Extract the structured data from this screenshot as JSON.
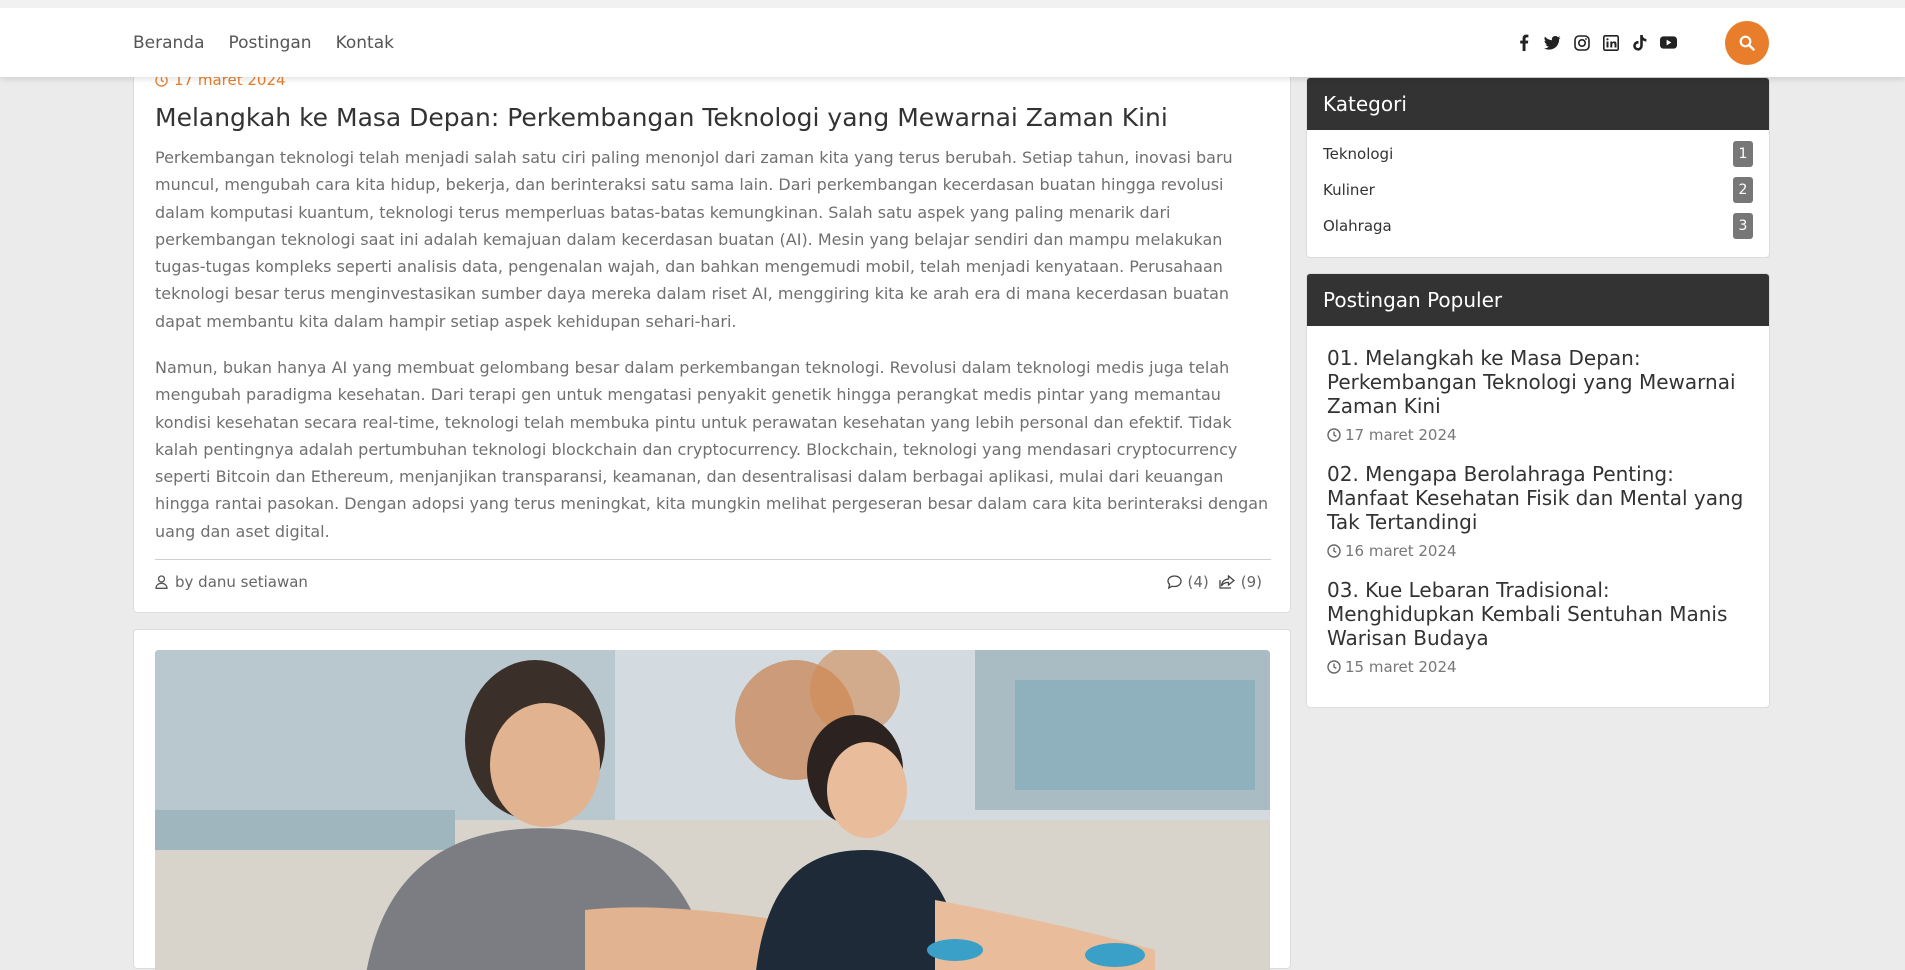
{
  "nav": {
    "items": [
      "Beranda",
      "Postingan",
      "Kontak"
    ]
  },
  "social": [
    "facebook-icon",
    "twitter-icon",
    "instagram-icon",
    "linkedin-icon",
    "tiktok-icon",
    "youtube-icon"
  ],
  "colors": {
    "accent": "#e87e2b",
    "header_dark": "#333333",
    "background": "#ebebeb"
  },
  "post1": {
    "date": "17 maret 2024",
    "title": "Melangkah ke Masa Depan: Perkembangan Teknologi yang Mewarnai Zaman Kini",
    "paragraph1": "Perkembangan teknologi telah menjadi salah satu ciri paling menonjol dari zaman kita yang terus berubah. Setiap tahun, inovasi baru muncul, mengubah cara kita hidup, bekerja, dan berinteraksi satu sama lain. Dari perkembangan kecerdasan buatan hingga revolusi dalam komputasi kuantum, teknologi terus memperluas batas-batas kemungkinan. Salah satu aspek yang paling menarik dari perkembangan teknologi saat ini adalah kemajuan dalam kecerdasan buatan (AI). Mesin yang belajar sendiri dan mampu melakukan tugas-tugas kompleks seperti analisis data, pengenalan wajah, dan bahkan mengemudi mobil, telah menjadi kenyataan. Perusahaan teknologi besar terus menginvestasikan sumber daya mereka dalam riset AI, menggiring kita ke arah era di mana kecerdasan buatan dapat membantu kita dalam hampir setiap aspek kehidupan sehari-hari.",
    "paragraph2": "Namun, bukan hanya AI yang membuat gelombang besar dalam perkembangan teknologi. Revolusi dalam teknologi medis juga telah mengubah paradigma kesehatan. Dari terapi gen untuk mengatasi penyakit genetik hingga perangkat medis pintar yang memantau kondisi kesehatan secara real-time, teknologi telah membuka pintu untuk perawatan kesehatan yang lebih personal dan efektif. Tidak kalah pentingnya adalah pertumbuhan teknologi blockchain dan cryptocurrency. Blockchain, teknologi yang mendasari cryptocurrency seperti Bitcoin dan Ethereum, menjanjikan transparansi, keamanan, dan desentralisasi dalam berbagai aplikasi, mulai dari keuangan hingga rantai pasokan. Dengan adopsi yang terus meningkat, kita mungkin melihat pergeseran besar dalam cara kita berinteraksi dengan uang dan aset digital.",
    "author": "by danu setiawan",
    "comments": "(4)",
    "shares": "(9)"
  },
  "sidebar": {
    "categories": {
      "title": "Kategori",
      "items": [
        {
          "label": "Teknologi",
          "count": "1"
        },
        {
          "label": "Kuliner",
          "count": "2"
        },
        {
          "label": "Olahraga",
          "count": "3"
        }
      ]
    },
    "popular": {
      "title": "Postingan Populer",
      "items": [
        {
          "title": "01. Melangkah ke Masa Depan: Perkembangan Teknologi yang Mewarnai Zaman Kini",
          "date": "17 maret 2024"
        },
        {
          "title": "02. Mengapa Berolahraga Penting: Manfaat Kesehatan Fisik dan Mental yang Tak Tertandingi",
          "date": "16 maret 2024"
        },
        {
          "title": "03. Kue Lebaran Tradisional: Menghidupkan Kembali Sentuhan Manis Warisan Budaya",
          "date": "15 maret 2024"
        }
      ]
    }
  }
}
